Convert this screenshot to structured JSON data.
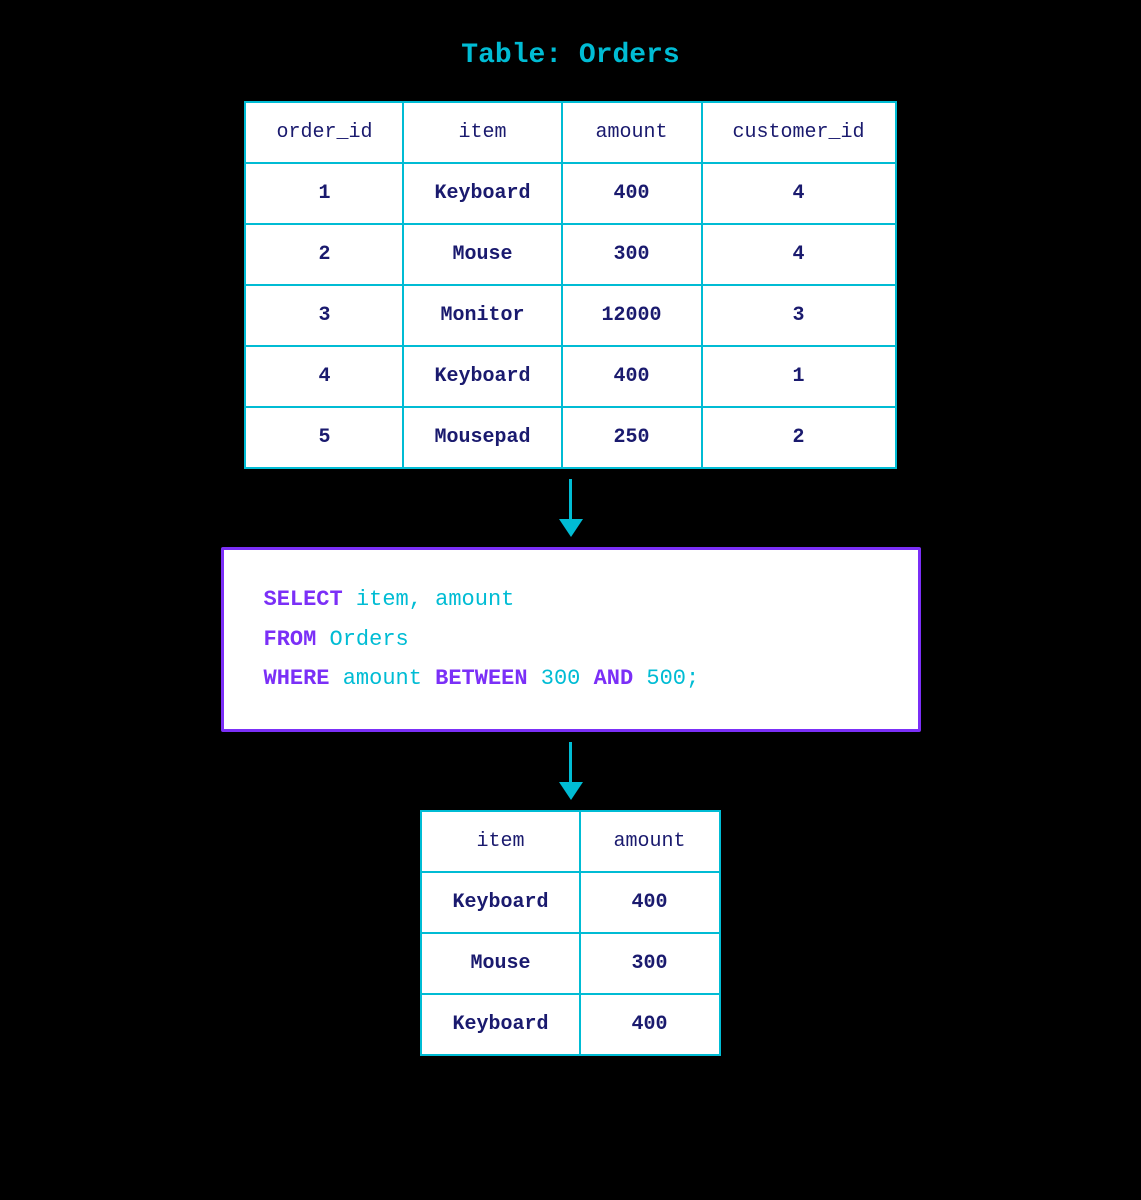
{
  "page": {
    "title": "Table: Orders",
    "background": "#000000"
  },
  "source_table": {
    "name": "Orders",
    "columns": [
      "order_id",
      "item",
      "amount",
      "customer_id"
    ],
    "rows": [
      [
        "1",
        "Keyboard",
        "400",
        "4"
      ],
      [
        "2",
        "Mouse",
        "300",
        "4"
      ],
      [
        "3",
        "Monitor",
        "12000",
        "3"
      ],
      [
        "4",
        "Keyboard",
        "400",
        "1"
      ],
      [
        "5",
        "Mousepad",
        "250",
        "2"
      ]
    ]
  },
  "sql_query": {
    "line1_keyword": "SELECT",
    "line1_rest": " item, amount",
    "line2_keyword": "FROM",
    "line2_rest": " Orders",
    "line3_keyword": "WHERE",
    "line3_middle": " amount ",
    "line3_keyword2": "BETWEEN",
    "line3_val1": " 300 ",
    "line3_keyword3": "AND",
    "line3_val2": " 500;"
  },
  "result_table": {
    "columns": [
      "item",
      "amount"
    ],
    "rows": [
      [
        "Keyboard",
        "400"
      ],
      [
        "Mouse",
        "300"
      ],
      [
        "Keyboard",
        "400"
      ]
    ]
  }
}
